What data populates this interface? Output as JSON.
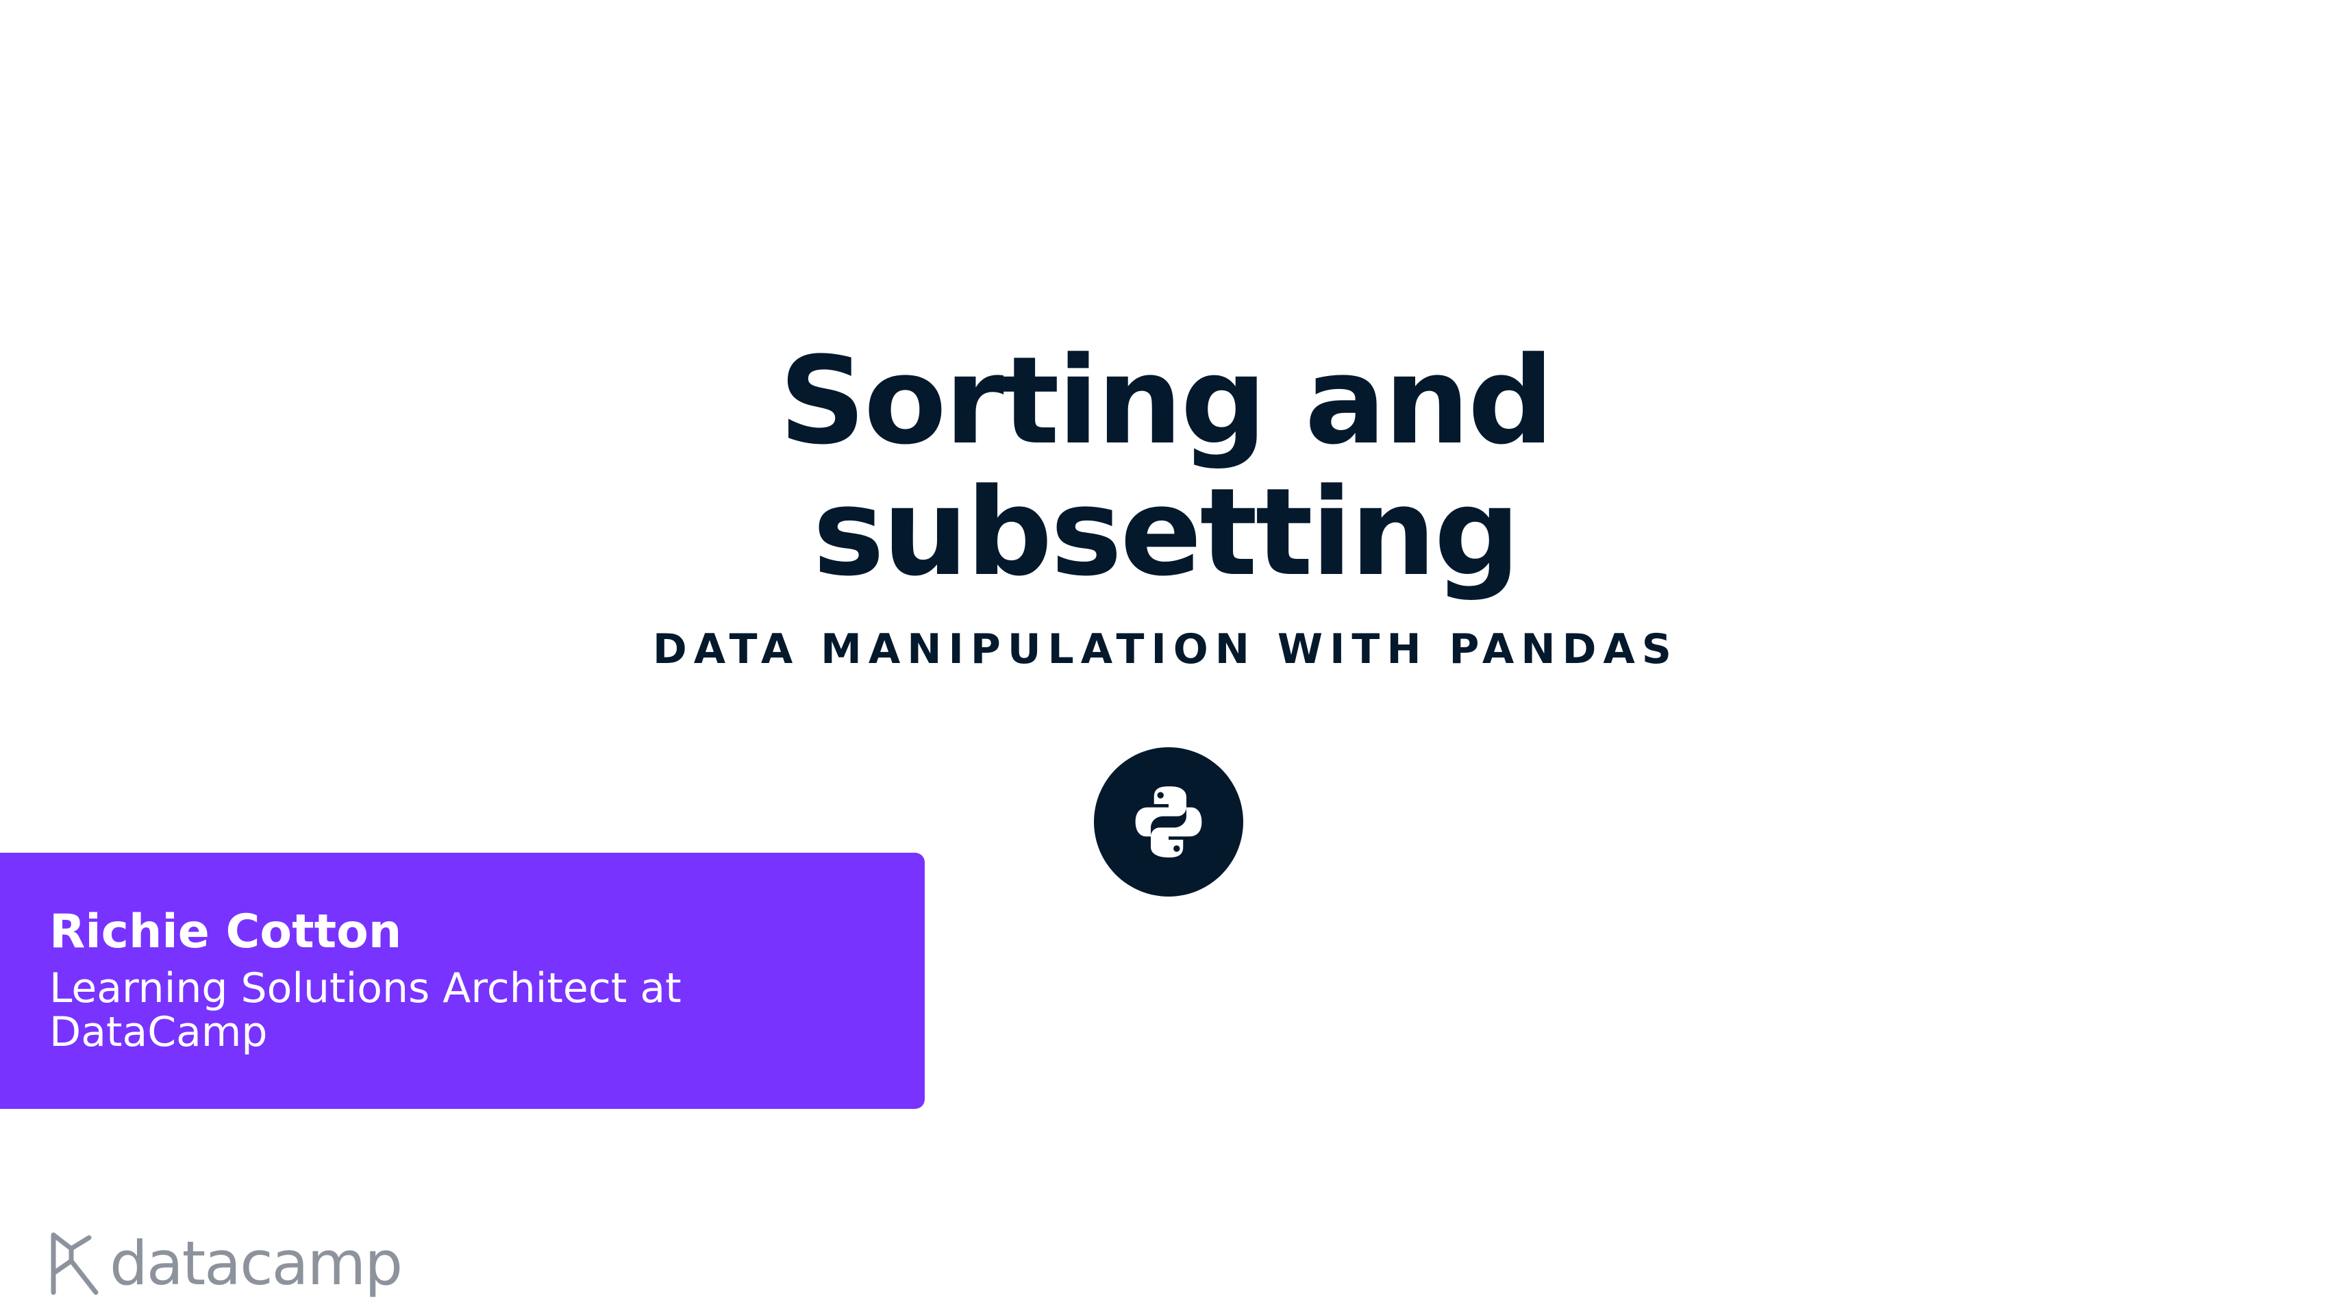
{
  "slide": {
    "title_line1": "Sorting and",
    "title_line2": "subsetting",
    "course_name": "DATA MANIPULATION WITH PANDAS",
    "badge_icon": "python-logo-icon"
  },
  "author": {
    "name": "Richie Cotton",
    "role_line1": "Learning Solutions Architect at",
    "role_line2": "DataCamp"
  },
  "brand": {
    "wordmark": "datacamp",
    "icon": "datacamp-logo-icon"
  },
  "colors": {
    "text_dark": "#05192d",
    "accent_purple": "#7933ff",
    "brand_gray": "#8d939d",
    "background": "#ffffff"
  }
}
